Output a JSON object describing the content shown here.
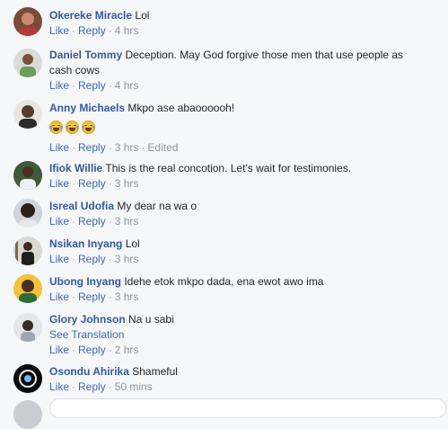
{
  "actions": {
    "like": "Like",
    "reply": "Reply",
    "separator": "·"
  },
  "comments": [
    {
      "author": "Okereke Miracle",
      "text": "Lol",
      "time": "4 hrs"
    },
    {
      "author": "Daniel Tommy",
      "text": "Deception. May God forgive those men that use people as",
      "text2": "cash cows",
      "time": "4 hrs"
    },
    {
      "author": "Anny Michaels",
      "text": "Mkpo ase abaoooooh!",
      "time": "3 hrs",
      "edited": "Edited"
    },
    {
      "author": "Ifiok Willie",
      "text": "This is the real concotion. Let's wait for testimonies.",
      "time": "3 hrs"
    },
    {
      "author": "Isreal Udofia",
      "text": "My dear na wa o",
      "time": "3 hrs"
    },
    {
      "author": "Nsikan Inyang",
      "text": "Lol",
      "time": "3 hrs"
    },
    {
      "author": "Ubong Inyang",
      "text": "Idehe etok mkpo dada, ena ewot awo ima",
      "time": "3 hrs"
    },
    {
      "author": "Glory Johnson",
      "text": "Na u sabi",
      "translation": "See Translation",
      "time": "2 hrs"
    },
    {
      "author": "Osondu Ahirika",
      "text": "Shameful",
      "time": "50 mins"
    }
  ],
  "emoji_icons": [
    "tears-of-joy-icon",
    "tears-of-joy-icon",
    "tears-of-joy-icon"
  ],
  "colors": {
    "author": "#365899",
    "link": "#4267b2",
    "meta": "#90949c",
    "background": "#f6f7f9"
  }
}
